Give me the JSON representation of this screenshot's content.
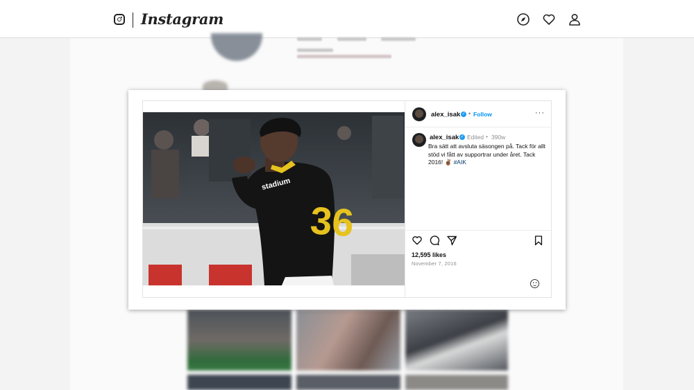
{
  "app": {
    "title": "Instagram",
    "nav_icons": [
      "compass-icon",
      "heart-icon",
      "profile-icon"
    ]
  },
  "post": {
    "username": "alex_isak",
    "follow_label": "Follow",
    "separator": "•",
    "more_label": "···",
    "edited_label": "Edited",
    "age": "390w",
    "caption_text": "Bra sätt att avsluta säsongen på. Tack för allt stöd vi fått av supportrar under året. Tack 2016! ✌🏾 ",
    "hashtag": "#AIK",
    "likes": "12,595 likes",
    "date": "November 7, 2016",
    "jersey_number": "36",
    "jersey_sponsor": "stadium"
  },
  "colors": {
    "follow_blue": "#0095f6",
    "verified_blue": "#1d9bf0",
    "hashtag": "#00376b",
    "jersey_yellow": "#e6c21e"
  }
}
